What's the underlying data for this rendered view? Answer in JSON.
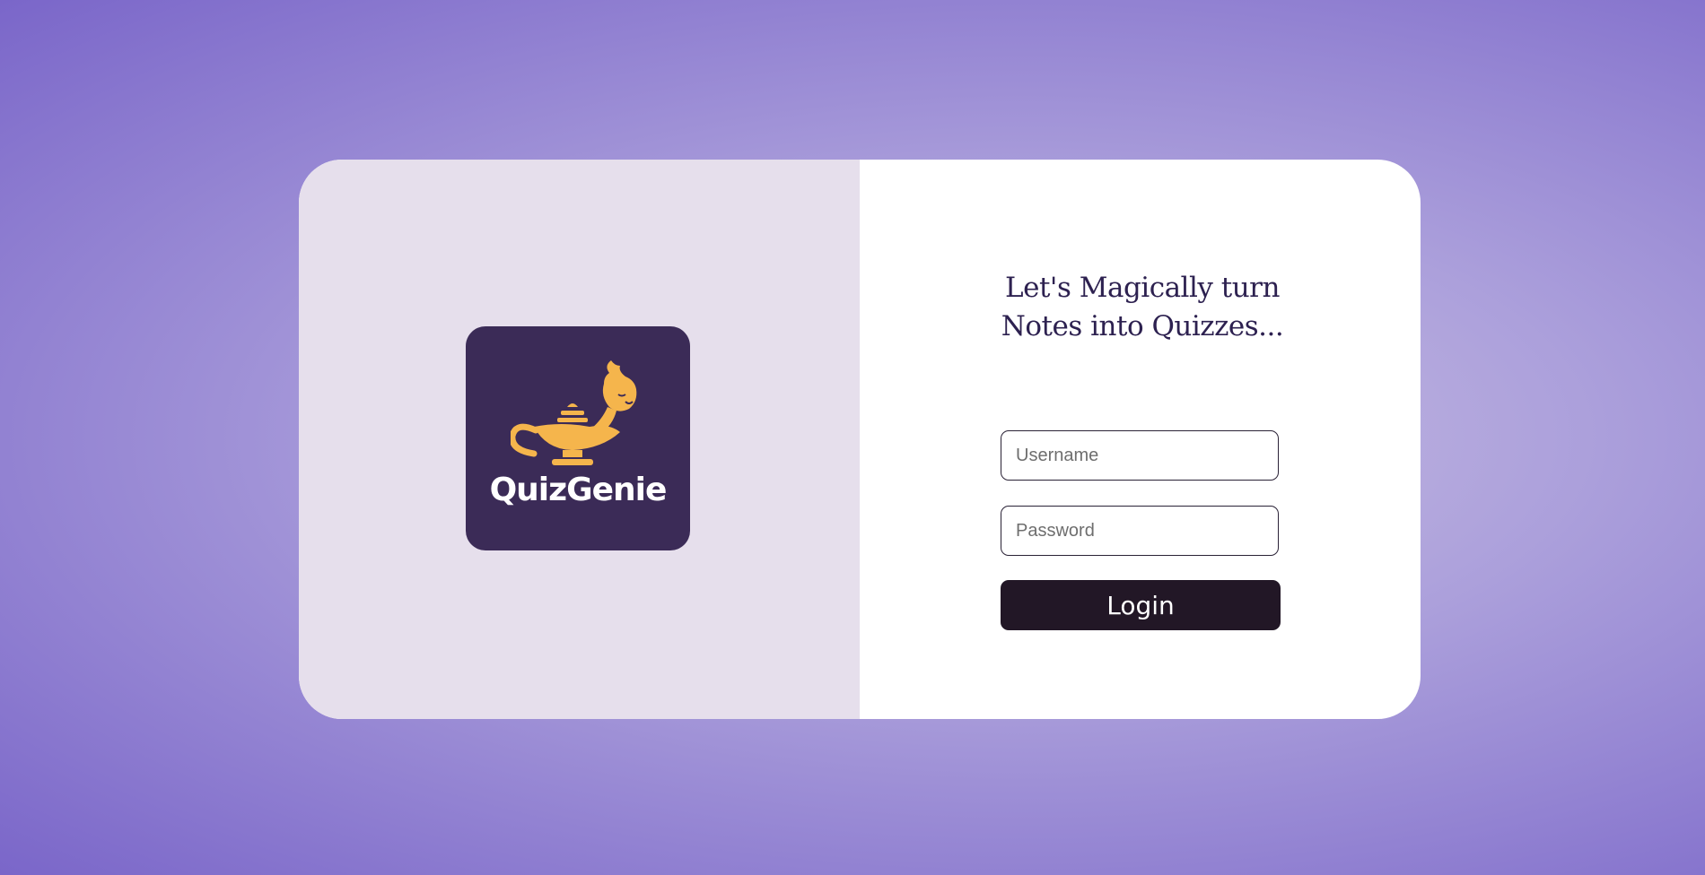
{
  "brand": {
    "name": "QuizGenie",
    "tile_color": "#3b2b57",
    "accent_color": "#f5b54c"
  },
  "hero": {
    "tagline_line1": "Let's Magically turn",
    "tagline_line2": "Notes into Quizzes..."
  },
  "form": {
    "username_placeholder": "Username",
    "password_placeholder": "Password",
    "login_label": "Login"
  }
}
